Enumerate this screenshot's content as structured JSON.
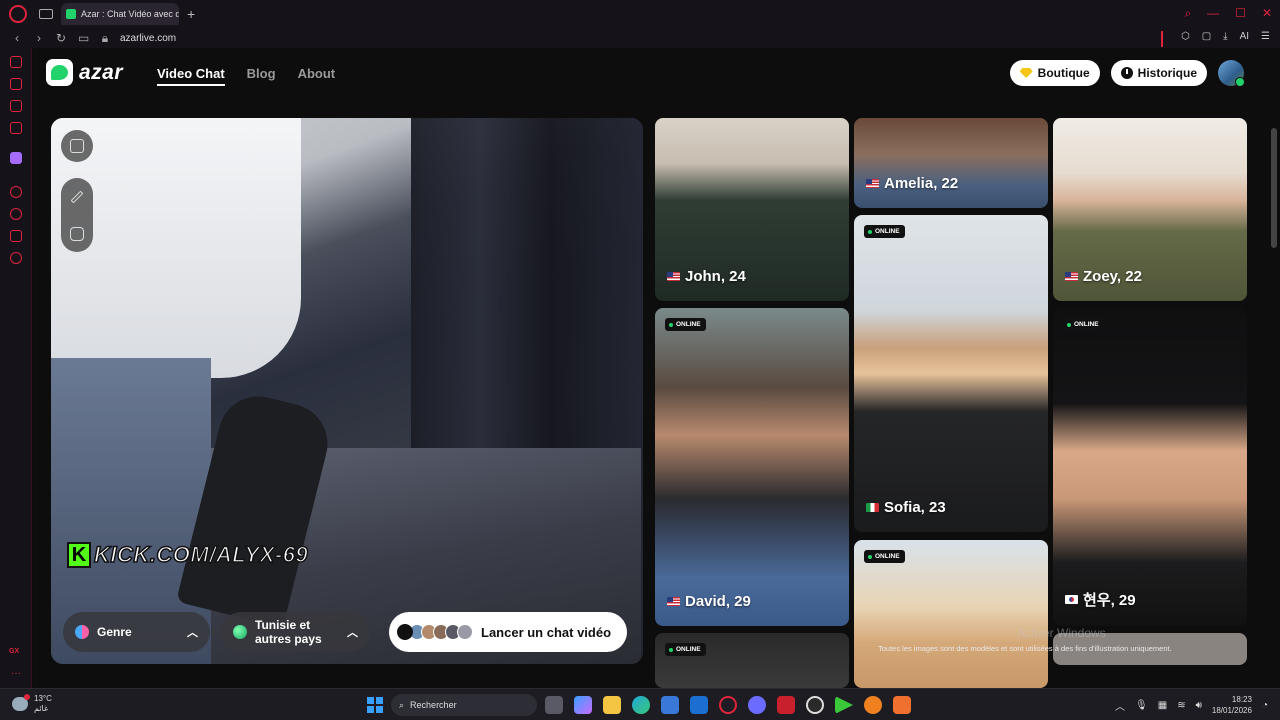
{
  "browser": {
    "tab_title": "Azar : Chat Vidéo avec de",
    "tab_close": "×",
    "new_tab": "+",
    "url": "azarlive.com",
    "ai_label": "AI"
  },
  "header": {
    "logo_text": "azar",
    "nav": [
      "Video Chat",
      "Blog",
      "About"
    ],
    "boutique_label": "Boutique",
    "historique_label": "Historique"
  },
  "video": {
    "watermark_letter": "K",
    "watermark_text": "KICK.COM/ALYX-69",
    "gender_label": "Genre",
    "country_label": "Tunisie et autres pays",
    "launch_label": "Lancer un chat vidéo"
  },
  "profiles": [
    {
      "name": "John, 24",
      "flag": "us",
      "online": false
    },
    {
      "name": "Amelia, 22",
      "flag": "us",
      "online": false
    },
    {
      "name": "Zoey, 22",
      "flag": "us",
      "online": false
    },
    {
      "name": "David, 29",
      "flag": "us",
      "online": true
    },
    {
      "name": "Sofia, 23",
      "flag": "it",
      "online": true
    },
    {
      "name": "현우, 29",
      "flag": "kr",
      "online": true
    }
  ],
  "online_badge": "ONLINE",
  "disclaimer": "Toutes les images sont des modèles et sont utilisées à des fins d'illustration uniquement.",
  "activate_windows": "Activer Windows",
  "taskbar": {
    "temperature": "13°C",
    "weather_text": "غائم",
    "search_placeholder": "Rechercher",
    "time": "18:23",
    "date": "18/01/2026"
  },
  "sidebar": {
    "gx_label": "GX",
    "more": "···"
  }
}
